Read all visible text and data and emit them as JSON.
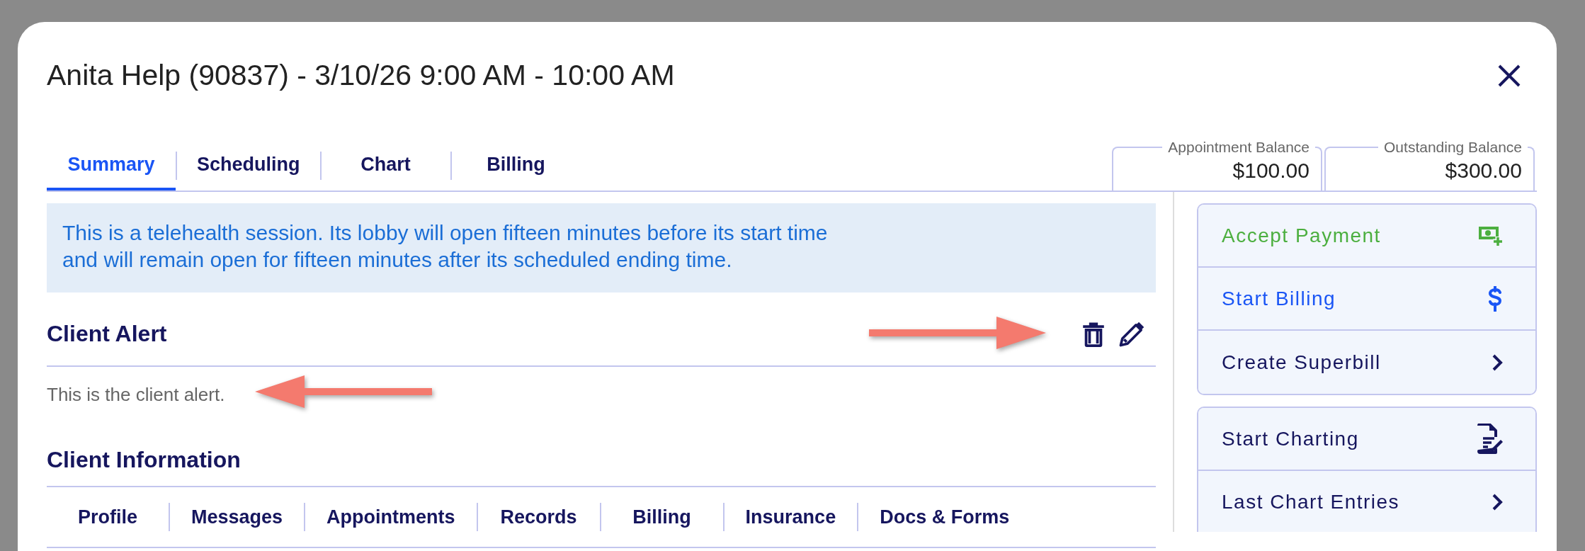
{
  "dialog": {
    "title": "Anita Help (90837) - 3/10/26 9:00 AM - 10:00 AM"
  },
  "tabs": [
    {
      "label": "Summary",
      "selected": true
    },
    {
      "label": "Scheduling",
      "selected": false
    },
    {
      "label": "Chart",
      "selected": false
    },
    {
      "label": "Billing",
      "selected": false
    }
  ],
  "balances": [
    {
      "label": "Appointment Balance",
      "amount": "$100.00"
    },
    {
      "label": "Outstanding Balance",
      "amount": "$300.00"
    }
  ],
  "notice": {
    "lines": [
      "This is a telehealth session. Its lobby will open fifteen minutes before its start time",
      "and will remain open for fifteen minutes after its scheduled ending time."
    ]
  },
  "client_alert": {
    "heading": "Client Alert",
    "text": "This is the client alert."
  },
  "client_information": {
    "heading": "Client Information",
    "tabs": [
      {
        "label": "Profile",
        "selected": false
      },
      {
        "label": "Messages",
        "selected": false
      },
      {
        "label": "Appointments",
        "selected": false
      },
      {
        "label": "Records",
        "selected": false
      },
      {
        "label": "Billing",
        "selected": false
      },
      {
        "label": "Insurance",
        "selected": false
      },
      {
        "label": "Docs & Forms",
        "selected": false
      }
    ]
  },
  "action_groups": [
    {
      "items": [
        {
          "label": "Accept Payment",
          "kind": "payment",
          "color": "#4caf3f"
        },
        {
          "label": "Start Billing",
          "kind": "billing",
          "color": "#1a55f5"
        },
        {
          "label": "Create Superbill",
          "kind": "link",
          "color": "#16165e"
        }
      ]
    },
    {
      "items": [
        {
          "label": "Start Charting",
          "kind": "charting",
          "color": "#16165e"
        },
        {
          "label": "Last Chart Entries",
          "kind": "link",
          "color": "#16165e"
        }
      ]
    }
  ],
  "annotations": [
    {
      "kind": "right-arrow"
    },
    {
      "kind": "left-arrow"
    }
  ]
}
